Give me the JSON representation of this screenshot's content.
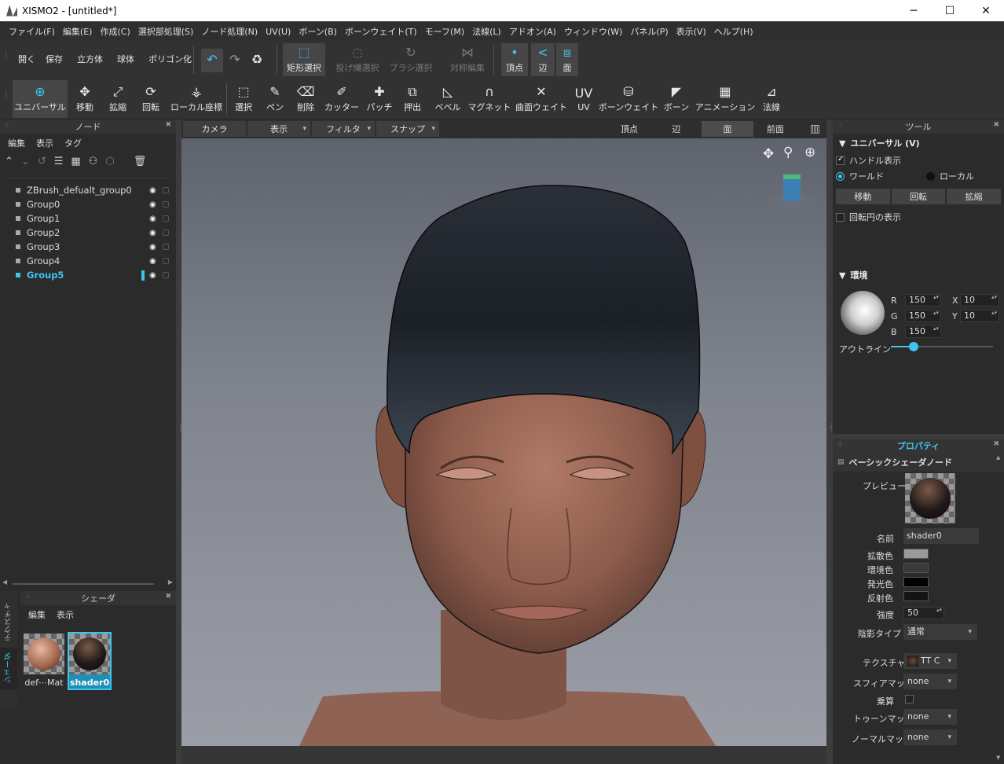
{
  "window": {
    "title": "XISMO2 - [untitled*]"
  },
  "menu": [
    "ファイル(F)",
    "編集(E)",
    "作成(C)",
    "選択部処理(S)",
    "ノード処理(N)",
    "UV(U)",
    "ボーン(B)",
    "ボーンウェイト(T)",
    "モーフ(M)",
    "法線(L)",
    "アドオン(A)",
    "ウィンドウ(W)",
    "パネル(P)",
    "表示(V)",
    "ヘルプ(H)"
  ],
  "toolbar1": {
    "open": "開く",
    "save": "保存",
    "cube": "立方体",
    "sphere": "球体",
    "polygon": "ポリゴン化",
    "rect_select": "矩形選択",
    "lasso_select": "投げ縄選択",
    "brush_select": "ブラシ選択",
    "sym_edit": "対称編集",
    "vertex": "頂点",
    "edge": "辺",
    "face": "面"
  },
  "toolbar2": {
    "universal": "ユニバーサル",
    "move": "移動",
    "scale": "拡縮",
    "rotate": "回転",
    "local_coord": "ローカル座標",
    "select": "選択",
    "pen": "ペン",
    "delete": "削除",
    "cutter": "カッター",
    "patch": "パッチ",
    "extrude": "押出",
    "bevel": "ベベル",
    "magnet": "マグネット",
    "surface_weight": "曲面ウェイト",
    "uv": "UV",
    "bone_weight": "ボーンウェイト",
    "bone": "ボーン",
    "animation": "アニメーション",
    "normal": "法線"
  },
  "node_panel": {
    "title": "ノード",
    "menu": [
      "編集",
      "表示",
      "タグ"
    ],
    "items": [
      {
        "name": "ZBrush_defualt_group0",
        "selected": false
      },
      {
        "name": "Group0",
        "selected": false
      },
      {
        "name": "Group1",
        "selected": false
      },
      {
        "name": "Group2",
        "selected": false
      },
      {
        "name": "Group3",
        "selected": false
      },
      {
        "name": "Group4",
        "selected": false
      },
      {
        "name": "Group5",
        "selected": true
      }
    ]
  },
  "shader_panel": {
    "title": "シェーダ",
    "menu": [
      "編集",
      "表示"
    ],
    "side_tabs": [
      "テクスチャ",
      "シェーダ"
    ],
    "items": [
      {
        "label": "def⋯Mat",
        "selected": false
      },
      {
        "label": "shader0",
        "selected": true
      }
    ]
  },
  "viewbar": {
    "camera": "カメラ",
    "display": "表示",
    "filter": "フィルタ",
    "snap": "スナップ",
    "vertex": "頂点",
    "edge": "辺",
    "face": "面",
    "front": "前面"
  },
  "tool_panel": {
    "title": "ツール",
    "universal_header": "ユニバーサル (V)",
    "handle_display": "ハンドル表示",
    "world": "ワールド",
    "local": "ローカル",
    "buttons": [
      "移動",
      "回転",
      "拡縮"
    ],
    "rotate_circle": "回転円の表示",
    "env_header": "環境",
    "r_label": "R",
    "r_value": "150",
    "g_label": "G",
    "g_value": "150",
    "b_label": "B",
    "b_value": "150",
    "x_label": "X",
    "x_value": "10",
    "y_label": "Y",
    "y_value": "10",
    "outline": "アウトライン",
    "outline_level": 0.22
  },
  "properties": {
    "title": "プロパティ",
    "header": "ベーシックシェーダノード",
    "preview": "プレビュー",
    "name_label": "名前",
    "name_value": "shader0",
    "diffuse_label": "拡散色",
    "diffuse_color": "#9a9a9a",
    "ambient_label": "環境色",
    "ambient_color": "#3a3a3a",
    "emissive_label": "発光色",
    "emissive_color": "#000000",
    "specular_label": "反射色",
    "specular_color": "#141414",
    "strength_label": "強度",
    "strength_value": "50",
    "shading_label": "陰影タイプ",
    "shading_value": "通常",
    "texture_label": "テクスチャ",
    "texture_value": "TT C",
    "sphere_map_label": "スフィアマップ",
    "sphere_map_value": "none",
    "multiply_label": "乗算",
    "toon_map_label": "トゥーンマップ",
    "toon_map_value": "none",
    "normal_map_label": "ノーマルマップ",
    "normal_map_value": "none"
  },
  "colors": {
    "accent": "#3fc4f0"
  }
}
